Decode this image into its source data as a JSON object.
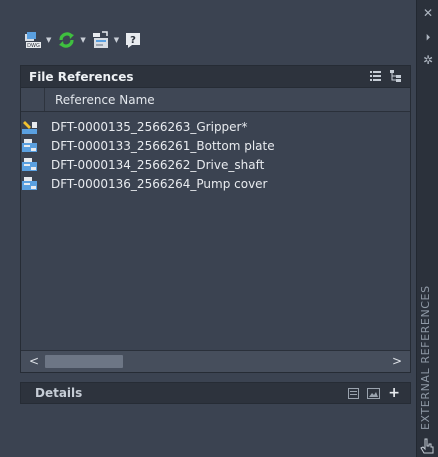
{
  "window": {
    "close_glyph": "✕",
    "autohide_glyph": "⏵",
    "settings_glyph": "✲",
    "vertical_title": "EXTERNAL REFERENCES"
  },
  "toolbar": {
    "attach_dwg_badge": "DWG",
    "arrow_glyph": "▼",
    "help_glyph": "?"
  },
  "file_references": {
    "title": "File References",
    "column_header": "Reference Name",
    "rows": [
      {
        "name": "DFT-0000135_2566263_Gripper*",
        "icon": "drawing-current-icon"
      },
      {
        "name": "DFT-0000133_2566261_Bottom plate",
        "icon": "drawing-xref-icon"
      },
      {
        "name": "DFT-0000134_2566262_Drive_shaft",
        "icon": "drawing-xref-icon"
      },
      {
        "name": "DFT-0000136_2566264_Pump cover",
        "icon": "drawing-xref-icon"
      }
    ]
  },
  "scrollbar": {
    "left_glyph": "<",
    "right_glyph": ">"
  },
  "details": {
    "title": "Details",
    "expand_glyph": "+"
  },
  "colors": {
    "accent_green": "#3fbf3f",
    "panel_bg": "#3b4351",
    "header_bg": "#2d333d"
  }
}
